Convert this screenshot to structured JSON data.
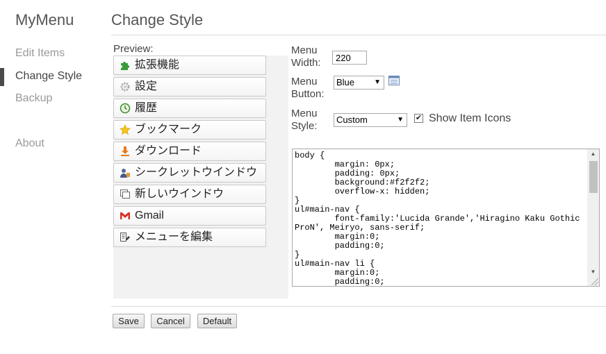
{
  "sidebar": {
    "app_title": "MyMenu",
    "items": [
      {
        "label": "Edit Items"
      },
      {
        "label": "Change Style"
      },
      {
        "label": "Backup"
      },
      {
        "label": "About"
      }
    ]
  },
  "header": {
    "title": "Change Style"
  },
  "preview": {
    "label": "Preview:",
    "menu_items": [
      {
        "label": "拡張機能",
        "icon": "puzzle-icon"
      },
      {
        "label": "設定",
        "icon": "gear-icon"
      },
      {
        "label": "履歴",
        "icon": "history-icon"
      },
      {
        "label": "ブックマーク",
        "icon": "star-icon"
      },
      {
        "label": "ダウンロード",
        "icon": "download-icon"
      },
      {
        "label": "シークレットウインドウ",
        "icon": "incognito-icon"
      },
      {
        "label": "新しいウインドウ",
        "icon": "new-window-icon"
      },
      {
        "label": "Gmail",
        "icon": "gmail-icon"
      },
      {
        "label": "メニューを編集",
        "icon": "edit-menu-icon"
      }
    ]
  },
  "settings": {
    "menu_width_label": "Menu Width:",
    "menu_width_value": "220",
    "menu_button_label": "Menu Button:",
    "menu_button_value": "Blue",
    "menu_style_label": "Menu Style:",
    "menu_style_value": "Custom",
    "show_icons_label": "Show Item Icons",
    "show_icons_checked": true
  },
  "css_code": "body {\n        margin: 0px;\n        padding: 0px;\n        background:#f2f2f2;\n        overflow-x: hidden;\n}\nul#main-nav {\n        font-family:'Lucida Grande','Hiragino Kaku Gothic ProN', Meiryo, sans-serif;\n        margin:0;\n        padding:0;\n}\nul#main-nav li {\n        margin:0;\n        padding:0;",
  "buttons": {
    "save": "Save",
    "cancel": "Cancel",
    "default": "Default"
  },
  "colors": {
    "preview_bg": "#f2f2f2",
    "accent_bar": "#4a4a4a"
  }
}
